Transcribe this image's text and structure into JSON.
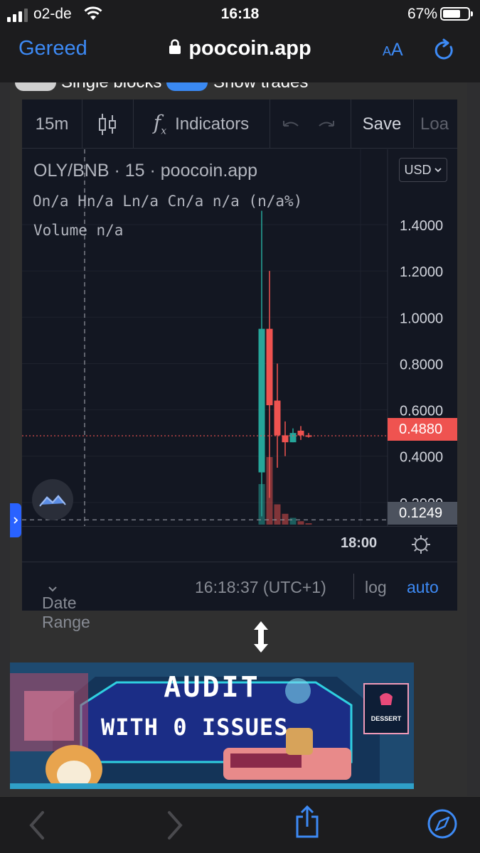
{
  "status": {
    "carrier": "o2-de",
    "time": "16:18",
    "battery": "67%"
  },
  "safari": {
    "done_label": "Gereed",
    "url": "poocoin.app",
    "aa_small": "A",
    "aa_large": "A"
  },
  "page": {
    "toggles": [
      {
        "label": "Single blocks",
        "on": false
      },
      {
        "label": "Show trades",
        "on": true
      }
    ]
  },
  "tv_toolbar": {
    "interval": "15m",
    "indicators_label": "Indicators",
    "save_label": "Save",
    "load_label": "Loa"
  },
  "legend": {
    "title": "OLY/BNB · 15 · poocoin.app",
    "ohlc": "On/a Hn/a Ln/a Cn/a n/a (n/a%)",
    "volume": "Volume n/a"
  },
  "price_scale": {
    "currency": "USD",
    "ticks": [
      "1.4000",
      "1.2000",
      "1.0000",
      "0.8000",
      "0.6000",
      "0.4000",
      "0.2000"
    ],
    "last_price": "0.4880",
    "crosshair_price": "0.1249",
    "last_price_color": "#ef5350",
    "up_color": "#26a69a",
    "down_color": "#ef5350"
  },
  "time_axis": {
    "label": "18:00"
  },
  "tv_bottom": {
    "date_range": "Date Range",
    "clock": "16:18:37 (UTC+1)",
    "log": "log",
    "auto": "auto"
  },
  "chart_data": {
    "type": "candlestick",
    "title": "OLY/BNB · 15 · poocoin.app",
    "ylim": [
      0,
      1.5
    ],
    "candles": [
      {
        "open": 0.33,
        "high": 1.46,
        "low": 0.14,
        "close": 0.95
      },
      {
        "open": 0.95,
        "high": 1.2,
        "low": 0.22,
        "close": 0.62
      },
      {
        "open": 0.64,
        "high": 0.8,
        "low": 0.35,
        "close": 0.49
      },
      {
        "open": 0.49,
        "high": 0.55,
        "low": 0.4,
        "close": 0.46
      },
      {
        "open": 0.46,
        "high": 0.52,
        "low": 0.46,
        "close": 0.5
      },
      {
        "open": 0.51,
        "high": 0.53,
        "low": 0.47,
        "close": 0.49
      },
      {
        "open": 0.49,
        "high": 0.5,
        "low": 0.48,
        "close": 0.488
      }
    ],
    "volumes": [
      0.6,
      1.0,
      0.3,
      0.16,
      0.1,
      0.05,
      0.02
    ],
    "last_price": 0.488,
    "crosshair_price": 0.1249
  },
  "banner": {
    "line1": "AUDIT",
    "line2": "WITH 0 ISSUES",
    "brand": "DESSERT"
  }
}
